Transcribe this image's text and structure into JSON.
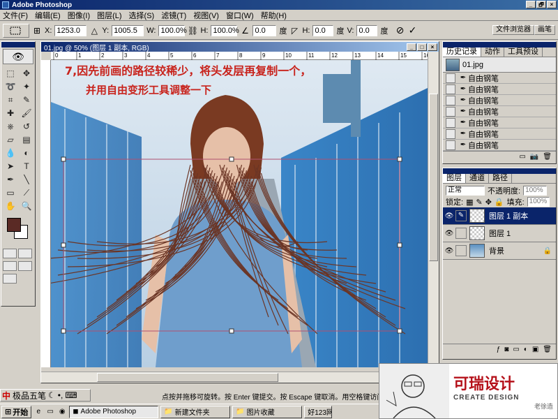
{
  "window": {
    "title": "Adobe Photoshop",
    "min": "_",
    "restore": "🗗",
    "close": "×"
  },
  "menu": [
    "文件(F)",
    "编辑(E)",
    "图像(I)",
    "图层(L)",
    "选择(S)",
    "滤镜(T)",
    "视图(V)",
    "窗口(W)",
    "帮助(H)"
  ],
  "options": {
    "x_label": "X:",
    "x_value": "1253.0",
    "y_label": "Y:",
    "y_value": "1005.5",
    "w_label": "W:",
    "w_value": "100.0%",
    "h_label": "H:",
    "h_value": "100.0%",
    "angle_value": "0.0",
    "angle_unit": "度",
    "hskew_label": "H:",
    "hskew_value": "0.0",
    "hskew_unit": "度",
    "vskew_label": "V:",
    "vskew_value": "0.0",
    "vskew_unit": "度",
    "cancel_icon": "⊘",
    "commit_icon": "✓"
  },
  "palette_well": {
    "tab1": "文件浏览器",
    "tab2": "画笔"
  },
  "document": {
    "title": "01.jpg @ 50% (图层 1 副本, RGB)",
    "annotation_line1": "7,因先前画的路径较稀少，将头发层再复制一个，",
    "annotation_line2": "并用自由变形工具调整一下",
    "ruler_numbers": [
      "0",
      "1",
      "2",
      "3",
      "4",
      "5",
      "6",
      "7",
      "8",
      "9",
      "10",
      "11",
      "12",
      "13",
      "14",
      "15",
      "16"
    ],
    "status_zoom": "50%"
  },
  "history": {
    "tabs": [
      "历史记录",
      "动作",
      "工具预设"
    ],
    "snapshot": "01.jpg",
    "steps": [
      "自由钢笔",
      "自由钢笔",
      "自由钢笔",
      "自由钢笔",
      "自由钢笔",
      "自由钢笔",
      "自由钢笔"
    ]
  },
  "layers": {
    "tabs": [
      "图层",
      "通道",
      "路径"
    ],
    "blend_mode": "正常",
    "opacity_label": "不透明度:",
    "opacity_value": "100%",
    "lock_label": "锁定:",
    "fill_label": "填充:",
    "fill_value": "100%",
    "items": [
      {
        "name": "图层 1 副本",
        "selected": true
      },
      {
        "name": "图层 1",
        "selected": false
      },
      {
        "name": "背景",
        "selected": false
      }
    ]
  },
  "ime": {
    "brand": "中",
    "name": "极品五笔"
  },
  "status_hint": "点按并拖移可旋转。按 Enter 键提交。按 Escape 键取消。用空格键访问",
  "taskbar": {
    "start": "开始",
    "tasks": [
      "Adobe Photoshop",
      "新建文件夹",
      "图片收藏",
      "好123网"
    ]
  },
  "logo": {
    "cn": "可瑞设计",
    "en": "CREATE DESIGN",
    "signature": "老徐造"
  },
  "colors": {
    "foreground": "#5a2a25",
    "background": "#ffffff",
    "annotation": "#c8231c",
    "titlebar": "#0a246a"
  }
}
